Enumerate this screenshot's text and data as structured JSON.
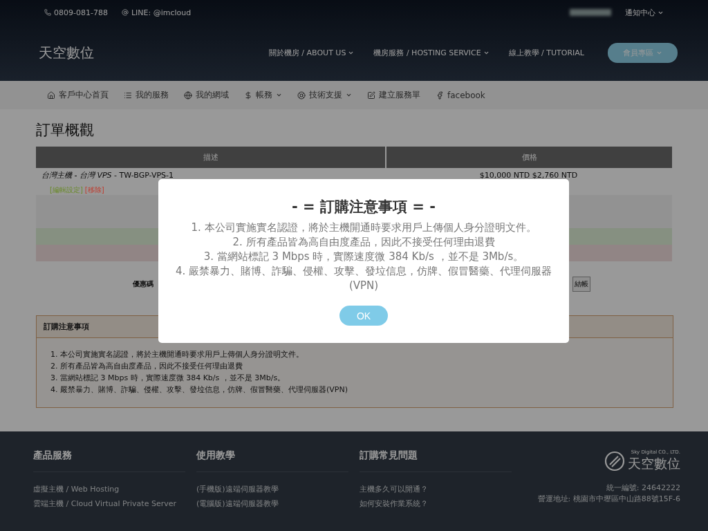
{
  "top_bar": {
    "phone": "0809-081-788",
    "line": "LINE: @imcloud",
    "notifications": "通知中心"
  },
  "header": {
    "logo": "天空數位",
    "nav": [
      {
        "label": "關於機房 / ABOUT US",
        "dropdown": true
      },
      {
        "label": "機房服務 / HOSTING SERVICE",
        "dropdown": true
      },
      {
        "label": "線上教學 / TUTORIAL",
        "dropdown": false
      }
    ],
    "member_button": "會員專區"
  },
  "subnav": [
    {
      "kind": "home",
      "label": "客戶中心首頁",
      "dropdown": false
    },
    {
      "kind": "list",
      "label": "我的服務",
      "dropdown": false
    },
    {
      "kind": "globe",
      "label": "我的網域",
      "dropdown": false
    },
    {
      "kind": "dollar",
      "label": "帳務",
      "dropdown": true
    },
    {
      "kind": "support",
      "label": "技術支援",
      "dropdown": true
    },
    {
      "kind": "edit",
      "label": "建立服務單",
      "dropdown": false
    },
    {
      "kind": "facebook",
      "label": "facebook",
      "dropdown": false
    }
  ],
  "page_title": "訂單概觀",
  "table": {
    "columns": [
      "描述",
      "價格"
    ],
    "item": {
      "description": "*台灣主機 - 台灣 VPS* - TW-BGP-VPS-1",
      "price": "$10,000 NTD $2,760 NTD",
      "actions": [
        {
          "kind": "edit",
          "label": "[編輯設定]"
        },
        {
          "kind": "remove",
          "label": "[移除]"
        }
      ]
    },
    "summary_rows": [
      {
        "kind": "neutral"
      },
      {
        "kind": "neutral"
      },
      {
        "kind": "positive"
      },
      {
        "kind": "negative"
      }
    ]
  },
  "coupon": {
    "label": "優惠碼",
    "checkout_button": "結帳"
  },
  "notice": {
    "title": "訂購注意事項",
    "items": [
      "1. 本公司實施實名認證，將於主機開通時要求用戶上傳個人身分證明文件。",
      "2. 所有產品皆為高自由度產品，因此不接受任何理由退費",
      "3. 當網站標記 3 Mbps 時，實際速度微 384 Kb/s ，並不是 3Mb/s。",
      "4. 嚴禁暴力、賭博、詐騙、侵權、攻擊、發垃信息，仿牌、假冒醫藥、代理伺服器(VPN)"
    ]
  },
  "modal": {
    "title": "- = 訂購注意事項 = -",
    "lines": [
      "1. 本公司實施實名認證，將於主機開通時要求用戶上傳個人身分證明文件。",
      "2. 所有產品皆為高自由度產品，因此不接受任何理由退費",
      "3. 當網站標記 3 Mbps 時，實際速度微 384 Kb/s ，並不是 3Mb/s。",
      "4. 嚴禁暴力、賭博、詐騙、侵權、攻擊、發垃信息，仿牌、假冒醫藥、代理伺服器(VPN)"
    ],
    "ok_button": "OK"
  },
  "footer": {
    "columns": [
      {
        "title": "產品服務",
        "links": [
          "虛擬主機 / Web Hosting",
          "雲端主機 / Cloud Virtual Private Server"
        ]
      },
      {
        "title": "使用教學",
        "links": [
          "(手機版)遠端伺服器教學",
          "(電腦版)遠端伺服器教學"
        ]
      },
      {
        "title": "訂購常見問題",
        "links": [
          "主機多久可以開通？",
          "如何安裝作業系統？"
        ]
      }
    ],
    "company_en": "Sky Digital CO., LTD.",
    "company": "天空數位",
    "tax_id": "統一編號: 24642222",
    "address": "營運地址: 桃園市中壢區中山路88號15F-6"
  }
}
